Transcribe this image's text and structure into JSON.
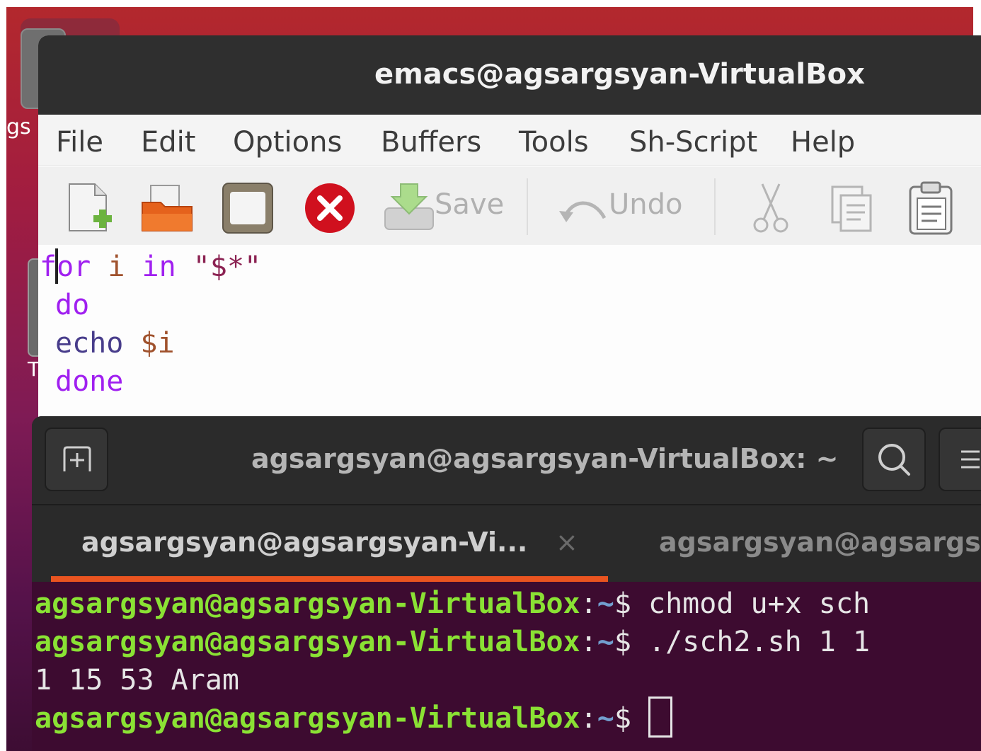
{
  "desktop": {
    "label_partial": "gs",
    "label_partial2": "T"
  },
  "emacs": {
    "title": "emacs@agsargsyan-VirtualBox",
    "menu": [
      "File",
      "Edit",
      "Options",
      "Buffers",
      "Tools",
      "Sh-Script",
      "Help"
    ],
    "toolbar": {
      "save_label": "Save",
      "undo_label": "Undo"
    },
    "code": {
      "line1": {
        "kw1": "for",
        "var": "i",
        "kw2": "in",
        "str": "\"$*\""
      },
      "line2": {
        "kw": "do"
      },
      "line3": {
        "cmd": "echo",
        "var": "$i"
      },
      "line4": {
        "kw": "done"
      }
    }
  },
  "terminal": {
    "title": "agsargsyan@agsargsyan-VirtualBox: ~",
    "tabs": [
      {
        "label": "agsargsyan@agsargsyan-Vi...",
        "active": true
      },
      {
        "label": "agsargsyan@agsargs",
        "active": false
      }
    ],
    "close_glyph": "×",
    "prompt_user": "agsargsyan@agsargsyan-VirtualBox",
    "prompt_sep": ":",
    "prompt_path": "~",
    "prompt_dollar": "$",
    "lines": [
      {
        "cmd": " chmod u+x sch"
      },
      {
        "cmd": " ./sch2.sh 1 1"
      }
    ],
    "output": "1 15 53 Aram",
    "colors": {
      "prompt_user": "#8ae234",
      "prompt_path": "#729fcf",
      "tab_accent": "#e95420",
      "background": "#3d0b30"
    }
  }
}
